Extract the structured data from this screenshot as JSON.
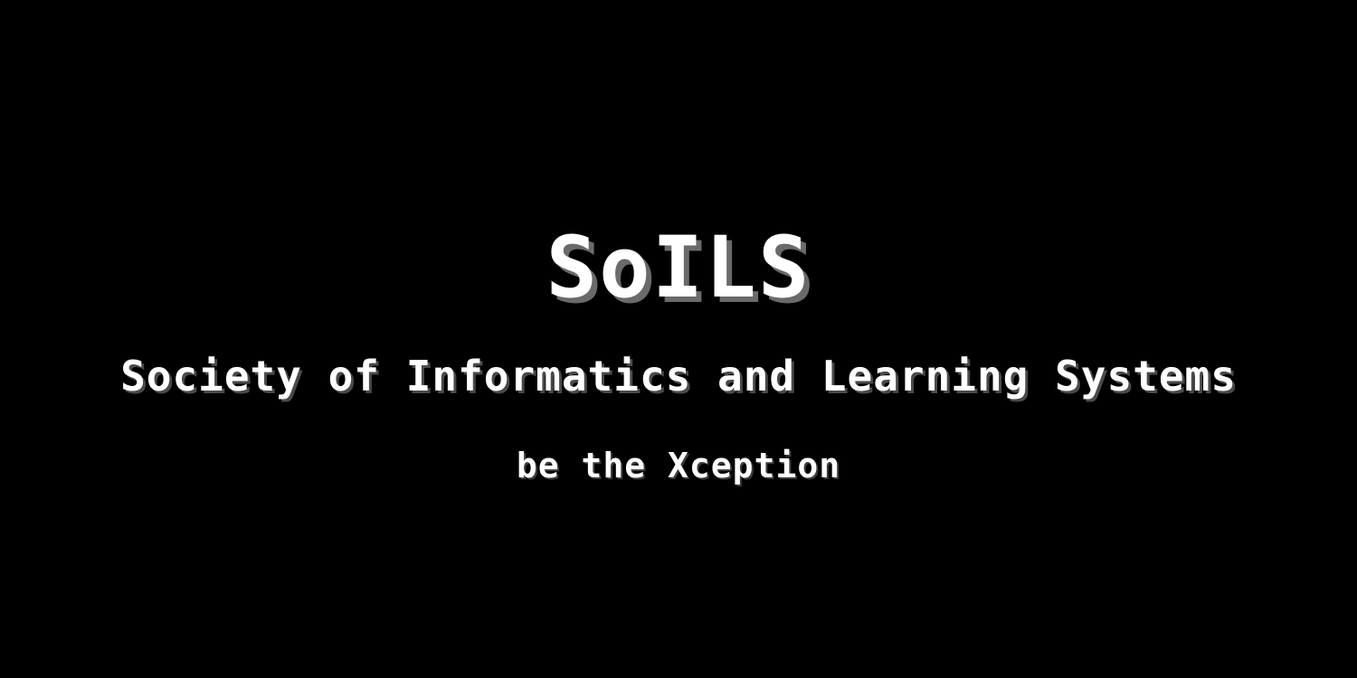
{
  "screen": {
    "title": "SoILS",
    "subtitle": "Society of Informatics and Learning Systems",
    "tagline": "be the Xception"
  },
  "colors": {
    "background": "#000000",
    "text": "#ffffff",
    "shadow": "#6a6a6a"
  }
}
